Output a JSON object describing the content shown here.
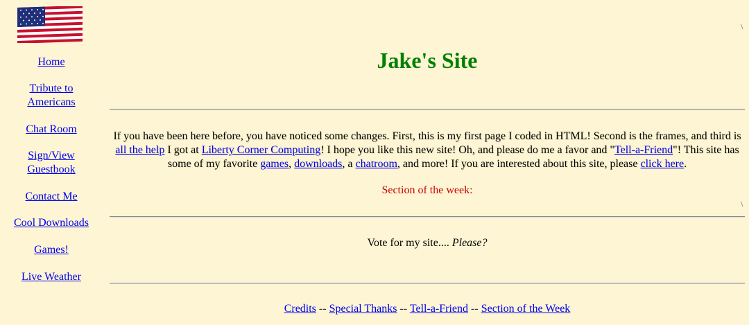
{
  "nav": {
    "items": [
      {
        "line1": "Home"
      },
      {
        "line1": "Tribute to",
        "line2": "Americans"
      },
      {
        "line1": "Chat Room"
      },
      {
        "line1": "Sign/View",
        "line2": "Guestbook"
      },
      {
        "line1": "Contact Me"
      },
      {
        "line1": "Cool Downloads"
      },
      {
        "line1": "Games!"
      },
      {
        "line1": "Live Weather"
      }
    ]
  },
  "main": {
    "title": "Jake's Site",
    "intro": {
      "t1": "If you have been here before, you have noticed some changes. First, this is my first page I coded in HTML! Second is the frames, and third is ",
      "link_help": "all the help",
      "t2": " I got at ",
      "link_liberty": "Liberty Corner Computing",
      "t3": "! I hope you like this new site! Oh, and please do me a favor and \"",
      "link_tell": "Tell-a-Friend",
      "t4": "\"! This site has some of my favorite ",
      "link_games": "games",
      "t5": ", ",
      "link_downloads": "downloads",
      "t6": ", a ",
      "link_chatroom": "chatroom",
      "t7": ", and more! If you are interested about this site, please ",
      "link_click": "click here",
      "t8": "."
    },
    "section_of_week": "Section of the week:",
    "vote_text": "Vote for my site.... ",
    "vote_please": "Please?",
    "footer": {
      "credits": "Credits",
      "special_thanks": "Special Thanks",
      "tell_a_friend": "Tell-a-Friend",
      "section_of_week": "Section of the Week",
      "separator": " -- "
    }
  },
  "colors": {
    "background": "#fdf5d3",
    "title": "#008000",
    "section_label": "#cc0000",
    "link": "#0000ee"
  },
  "icons": {
    "flag": "american-flag-icon"
  }
}
